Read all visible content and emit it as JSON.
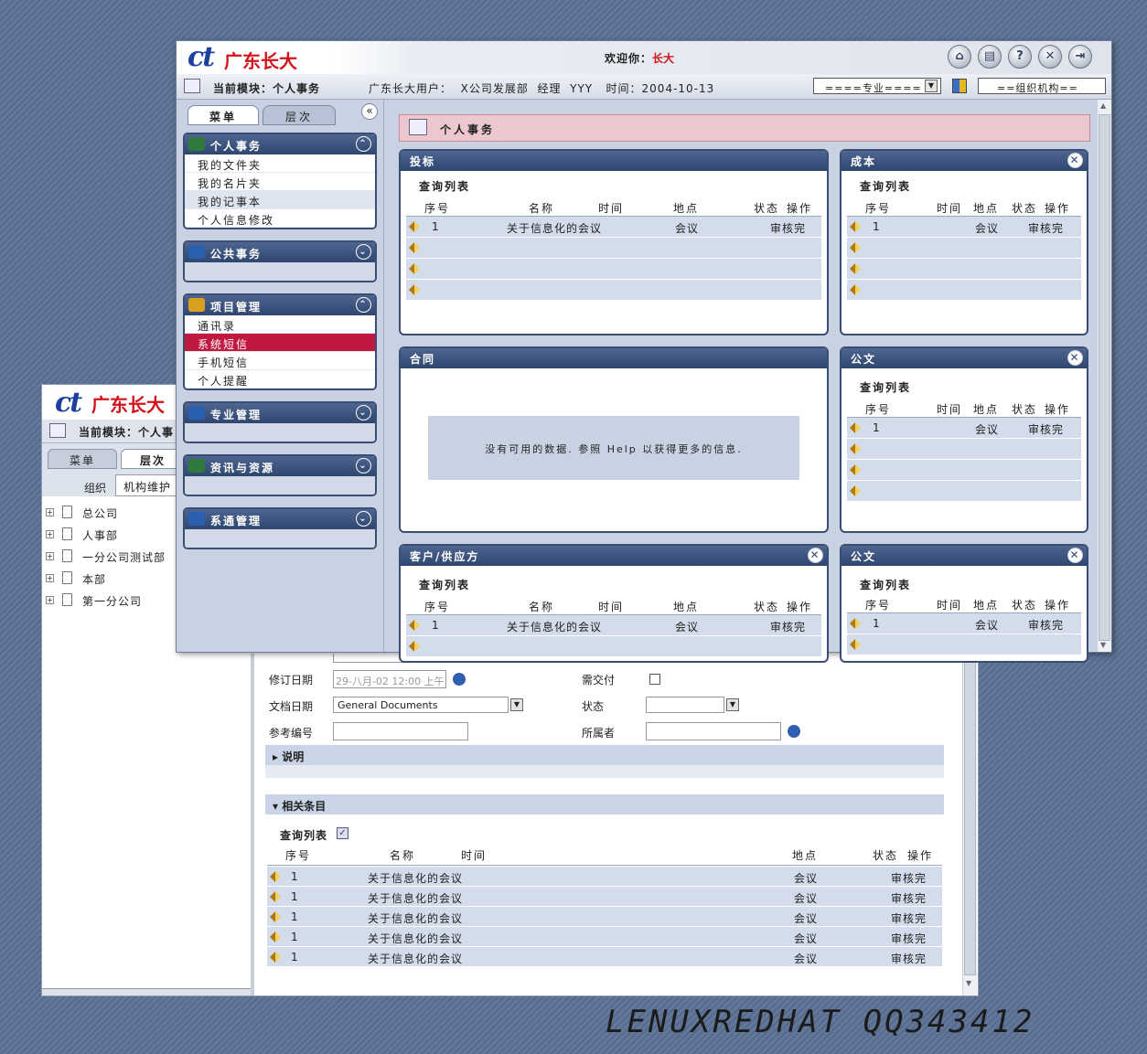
{
  "logo": {
    "mark": "ct",
    "text": "广东长大"
  },
  "front": {
    "welcome_label": "欢迎你：",
    "welcome_user": "长大",
    "module_label": "当前模块：个人事务",
    "user_info": "广东长大用户：  X公司发展部  经理  YYY   时间：2004-10-13",
    "specialty_select": "====专业====",
    "org_box": "==组织机构==",
    "tabs": [
      "菜单",
      "层次"
    ],
    "collapse_glyph": "«",
    "main_title": "个人事务",
    "sidebar": [
      {
        "title": "个人事务",
        "toggle": "⌃",
        "items": [
          "我的文件夹",
          "我的名片夹",
          "我的记事本",
          "个人信息修改"
        ],
        "highlighted": 2
      },
      {
        "title": "公共事务",
        "toggle": "⌄",
        "items": []
      },
      {
        "title": "项目管理",
        "toggle": "⌃",
        "items": [
          "通讯录",
          "系统短信",
          "手机短信",
          "个人提醒"
        ],
        "selected": 1
      },
      {
        "title": "专业管理",
        "toggle": "⌄",
        "items": []
      },
      {
        "title": "资讯与资源",
        "toggle": "⌄",
        "items": []
      },
      {
        "title": "系通管理",
        "toggle": "⌄",
        "items": []
      }
    ],
    "panels": {
      "bid": {
        "title": "投标",
        "sub": "查询列表",
        "headers": [
          "序号",
          "名称",
          "时间",
          "地点",
          "状态",
          "操作"
        ],
        "row": {
          "no": "1",
          "name": "关于信息化的会议",
          "place": "会议",
          "status": "审核完"
        }
      },
      "cost": {
        "title": "成本",
        "sub": "查询列表",
        "headers": [
          "序号",
          "时间",
          "地点",
          "状态",
          "操作"
        ],
        "row": {
          "no": "1",
          "place": "会议",
          "status": "审核完"
        }
      },
      "contract": {
        "title": "合同",
        "empty": "没有可用的数据.  参照 Help 以获得更多的信息."
      },
      "doc1": {
        "title": "公文",
        "sub": "查询列表",
        "headers": [
          "序号",
          "时间",
          "地点",
          "状态",
          "操作"
        ],
        "row": {
          "no": "1",
          "place": "会议",
          "status": "审核完"
        }
      },
      "client": {
        "title": "客户/供应方",
        "sub": "查询列表",
        "headers": [
          "序号",
          "名称",
          "时间",
          "地点",
          "状态",
          "操作"
        ],
        "row": {
          "no": "1",
          "name": "关于信息化的会议",
          "place": "会议",
          "status": "审核完"
        }
      },
      "doc2": {
        "title": "公文",
        "sub": "查询列表",
        "headers": [
          "序号",
          "时间",
          "地点",
          "状态",
          "操作"
        ],
        "row": {
          "no": "1",
          "place": "会议",
          "status": "审核完"
        }
      }
    }
  },
  "back": {
    "module_label": "当前模块：个人事",
    "tabs": [
      "菜单",
      "层次"
    ],
    "org_label": "组织",
    "org_button": "机构维护",
    "tree": [
      "总公司",
      "人事部",
      "一分公司测试部",
      "本部",
      "第一分公司"
    ],
    "form": {
      "revision_date_label": "修订日期",
      "revision_date_value": "29-八月-02 12:00 上午",
      "doc_date_label": "文档日期",
      "doc_date_value": "General Documents",
      "ref_label": "参考编号",
      "deliver_label": "需交付",
      "status_label": "状态",
      "owner_label": "所属者"
    },
    "desc_section": "说明",
    "related_section": "相关条目",
    "query_label": "查询列表",
    "table_headers": [
      "序号",
      "名称",
      "时间",
      "地点",
      "状态",
      "操作"
    ],
    "rows": [
      {
        "no": "1",
        "name": "关于信息化的会议",
        "place": "会议",
        "status": "审核完"
      },
      {
        "no": "1",
        "name": "关于信息化的会议",
        "place": "会议",
        "status": "审核完"
      },
      {
        "no": "1",
        "name": "关于信息化的会议",
        "place": "会议",
        "status": "审核完"
      },
      {
        "no": "1",
        "name": "关于信息化的会议",
        "place": "会议",
        "status": "审核完"
      },
      {
        "no": "1",
        "name": "关于信息化的会议",
        "place": "会议",
        "status": "审核完"
      }
    ]
  },
  "watermark": "LENUXREDHAT QQ343412"
}
